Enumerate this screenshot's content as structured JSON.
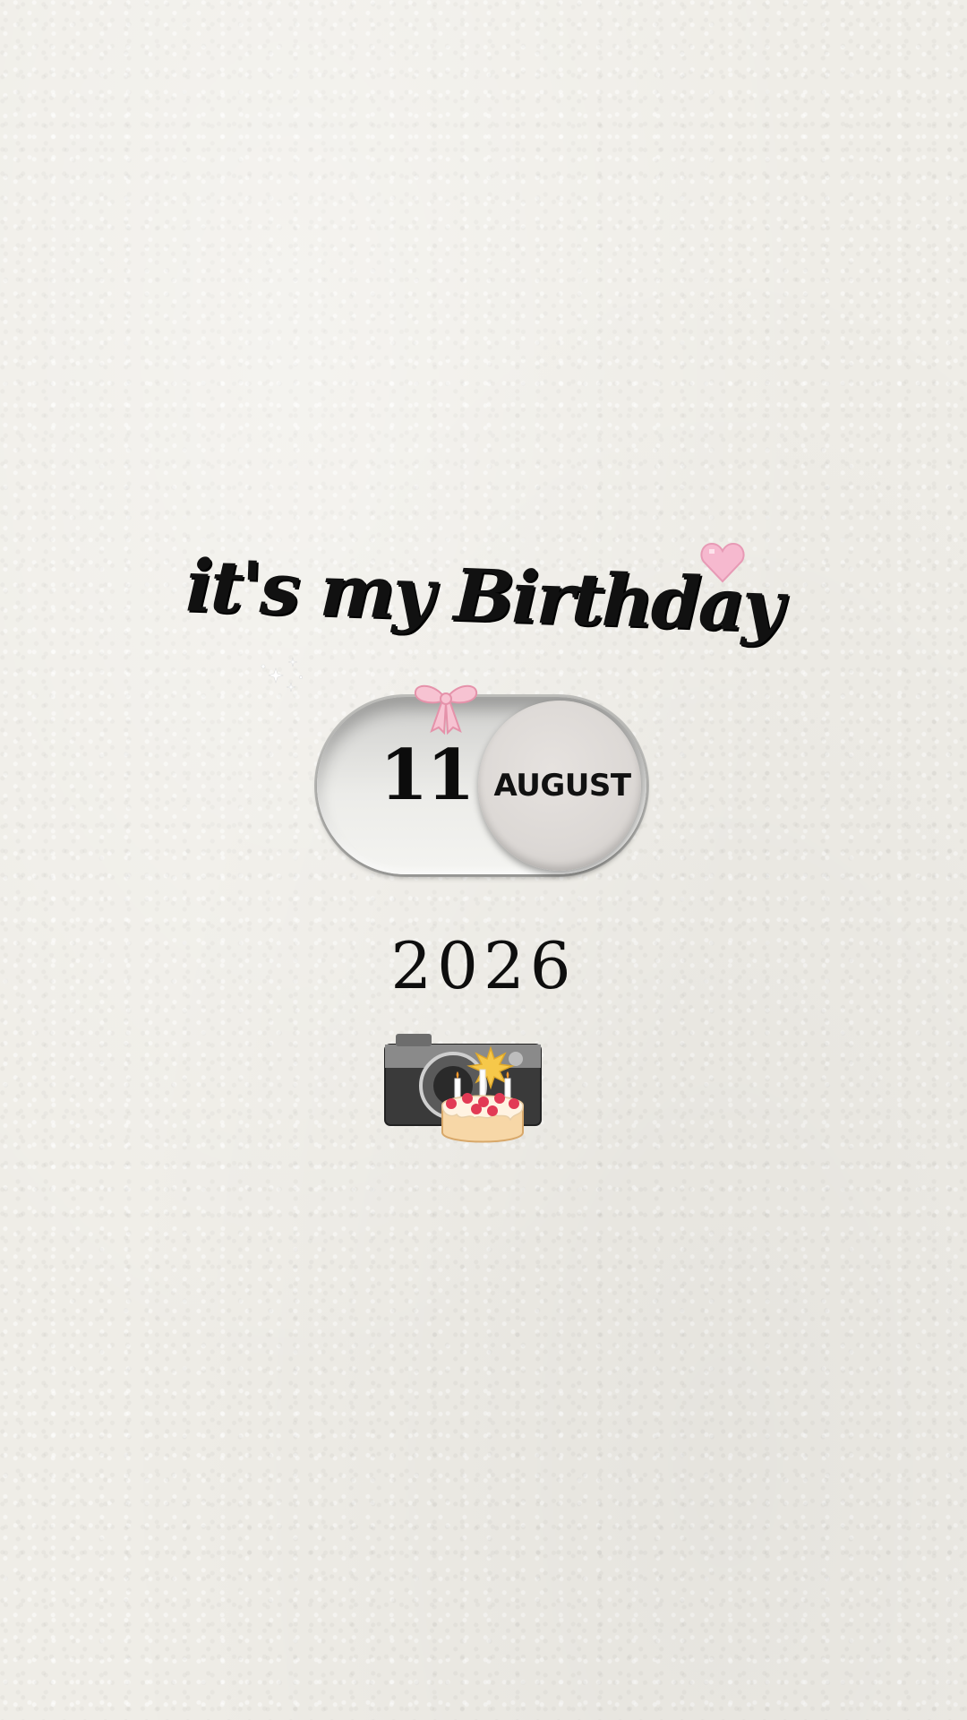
{
  "title": "it's my Birthday",
  "date": {
    "day": "11",
    "month": "AUGUST"
  },
  "year": "2026",
  "decorations": {
    "heart": "heart-icon",
    "sparkle": "sparkle-icon",
    "bow": "bow-icon",
    "camera": "camera-icon",
    "cake": "cake-icon"
  },
  "colors": {
    "background": "#efede7",
    "heart": "#f6b9cf",
    "bow": "#f4b8c8",
    "text": "#111111"
  }
}
